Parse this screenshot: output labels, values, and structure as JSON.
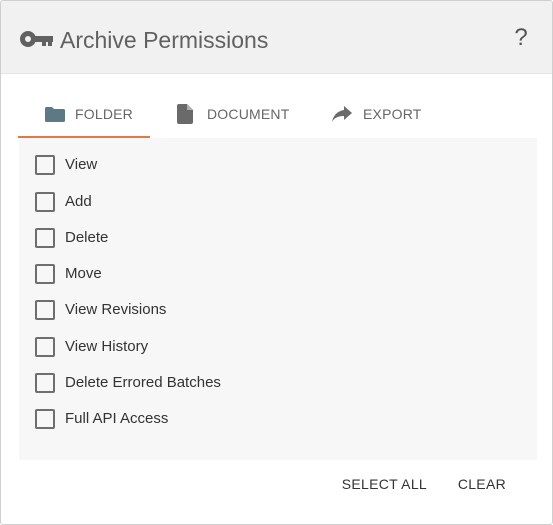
{
  "dialog": {
    "title": "Archive Permissions",
    "title_icon": "key-icon",
    "help_label": "?",
    "accent_color": "#e8763f",
    "folder_icon_color": "#5f7886"
  },
  "tabs": [
    {
      "label": "FOLDER",
      "icon": "folder-icon",
      "active": true
    },
    {
      "label": "DOCUMENT",
      "icon": "document-icon",
      "active": false
    },
    {
      "label": "EXPORT",
      "icon": "share-arrow-icon",
      "active": false
    }
  ],
  "permissions": [
    {
      "label": "View",
      "checked": false
    },
    {
      "label": "Add",
      "checked": false
    },
    {
      "label": "Delete",
      "checked": false
    },
    {
      "label": "Move",
      "checked": false
    },
    {
      "label": "View Revisions",
      "checked": false
    },
    {
      "label": "View History",
      "checked": false
    },
    {
      "label": "Delete Errored Batches",
      "checked": false
    },
    {
      "label": "Full API Access",
      "checked": false
    }
  ],
  "actions": {
    "select_all_label": "SELECT ALL",
    "clear_label": "CLEAR"
  }
}
